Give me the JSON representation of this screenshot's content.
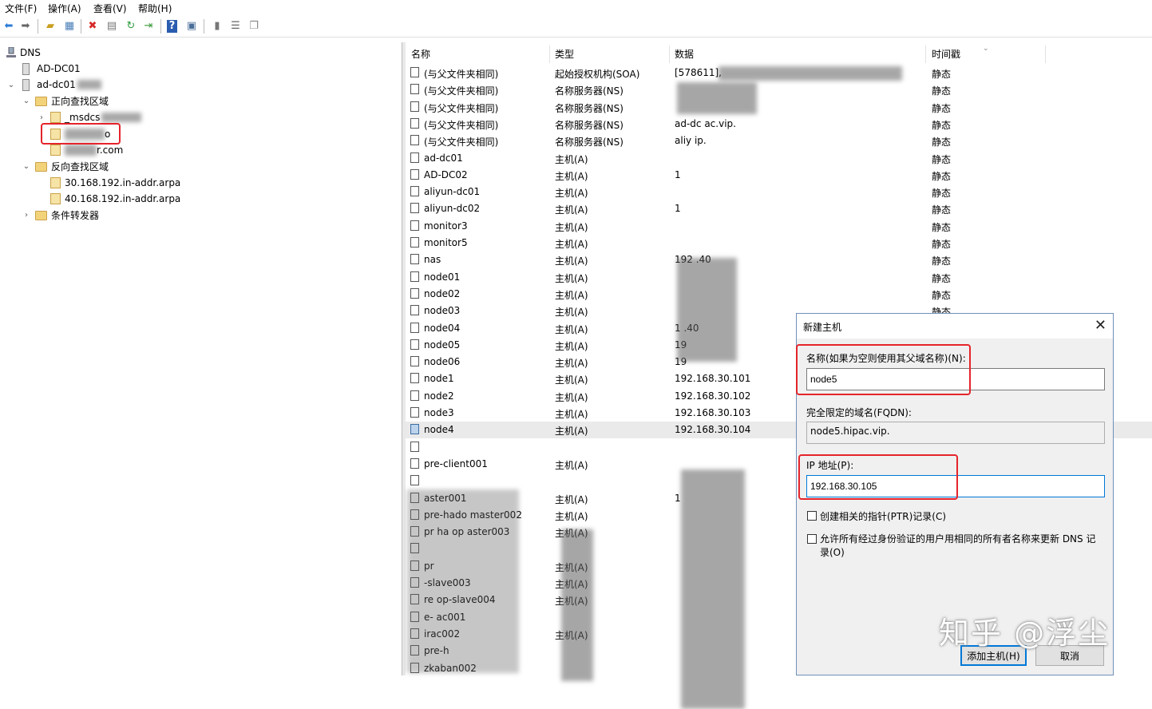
{
  "menu": [
    "文件(F)",
    "操作(A)",
    "查看(V)",
    "帮助(H)"
  ],
  "toolbar_icons": [
    "back-icon",
    "forward-icon",
    "up-folder-icon",
    "show-tree-icon",
    "delete-icon",
    "properties-icon",
    "refresh-icon",
    "export-icon",
    "help-icon",
    "view-icon",
    "server-icon",
    "list-icon",
    "records-icon"
  ],
  "tree": {
    "root": "DNS",
    "server1": "AD-DC01",
    "server2": "ad-dc01",
    "forward_zones": "正向查找区域",
    "msdcs": "_msdcs",
    "zone_hidden_suffix": "o",
    "zone_com_suffix": "r.com",
    "reverse_zones": "反向查找区域",
    "rev1": "30.168.192.in-addr.arpa",
    "rev2": "40.168.192.in-addr.arpa",
    "forwarders": "条件转发器"
  },
  "list": {
    "headers": [
      "名称",
      "类型",
      "数据",
      "时间戳"
    ],
    "rows": [
      {
        "name": "(与父文件夹相同)",
        "type": "起始授权机构(SOA)",
        "data": "[578611],",
        "ts": "静态"
      },
      {
        "name": "(与父文件夹相同)",
        "type": "名称服务器(NS)",
        "data": "",
        "ts": "静态"
      },
      {
        "name": "(与父文件夹相同)",
        "type": "名称服务器(NS)",
        "data": "",
        "ts": "静态"
      },
      {
        "name": "(与父文件夹相同)",
        "type": "名称服务器(NS)",
        "data": "ad-dc        ac.vip.",
        "ts": "静态"
      },
      {
        "name": "(与父文件夹相同)",
        "type": "名称服务器(NS)",
        "data": "aliy              ip.",
        "ts": "静态"
      },
      {
        "name": "ad-dc01",
        "type": "主机(A)",
        "data": "",
        "ts": "静态"
      },
      {
        "name": "AD-DC02",
        "type": "主机(A)",
        "data": "1",
        "ts": "静态"
      },
      {
        "name": "aliyun-dc01",
        "type": "主机(A)",
        "data": "",
        "ts": "静态"
      },
      {
        "name": "aliyun-dc02",
        "type": "主机(A)",
        "data": "1",
        "ts": "静态"
      },
      {
        "name": "monitor3",
        "type": "主机(A)",
        "data": "",
        "ts": "静态"
      },
      {
        "name": "monitor5",
        "type": "主机(A)",
        "data": "",
        "ts": "静态"
      },
      {
        "name": "nas",
        "type": "主机(A)",
        "data": "192    .40",
        "ts": "静态"
      },
      {
        "name": "node01",
        "type": "主机(A)",
        "data": "",
        "ts": "静态"
      },
      {
        "name": "node02",
        "type": "主机(A)",
        "data": "",
        "ts": "静态"
      },
      {
        "name": "node03",
        "type": "主机(A)",
        "data": "",
        "ts": "静态"
      },
      {
        "name": "node04",
        "type": "主机(A)",
        "data": "1     .40",
        "ts": ""
      },
      {
        "name": "node05",
        "type": "主机(A)",
        "data": "19",
        "ts": ""
      },
      {
        "name": "node06",
        "type": "主机(A)",
        "data": "19",
        "ts": ""
      },
      {
        "name": "node1",
        "type": "主机(A)",
        "data": "192.168.30.101",
        "ts": ""
      },
      {
        "name": "node2",
        "type": "主机(A)",
        "data": "192.168.30.102",
        "ts": ""
      },
      {
        "name": "node3",
        "type": "主机(A)",
        "data": "192.168.30.103",
        "ts": ""
      },
      {
        "name": "node4",
        "type": "主机(A)",
        "data": "192.168.30.104",
        "ts": ""
      },
      {
        "name": "",
        "type": "",
        "data": "",
        "ts": ""
      },
      {
        "name": "pre-client001",
        "type": "主机(A)",
        "data": "",
        "ts": ""
      },
      {
        "name": "",
        "type": "",
        "data": "",
        "ts": ""
      },
      {
        "name": "aster001",
        "type": "主机(A)",
        "data": "1",
        "ts": ""
      },
      {
        "name": "pre-hado   master002",
        "type": "主机(A)",
        "data": "",
        "ts": ""
      },
      {
        "name": "pr  ha  op aster003",
        "type": "主机(A)",
        "data": "",
        "ts": ""
      },
      {
        "name": "",
        "type": "",
        "data": "",
        "ts": ""
      },
      {
        "name": "pr",
        "type": "主机(A)",
        "data": "",
        "ts": ""
      },
      {
        "name": "-slave003",
        "type": "主机(A)",
        "data": "",
        "ts": ""
      },
      {
        "name": "re    op-slave004",
        "type": "主机(A)",
        "data": "",
        "ts": ""
      },
      {
        "name": "e-   ac001",
        "type": "",
        "data": "",
        "ts": ""
      },
      {
        "name": "  irac002",
        "type": "主机(A)",
        "data": "",
        "ts": ""
      },
      {
        "name": "pre-h",
        "type": "",
        "data": "",
        "ts": ""
      },
      {
        "name": "  zkaban002",
        "type": "",
        "data": "",
        "ts": ""
      }
    ]
  },
  "dialog": {
    "title": "新建主机",
    "close": "✕",
    "name_label": "名称(如果为空则使用其父域名称)(N):",
    "name_value": "node5",
    "fqdn_label": "完全限定的域名(FQDN):",
    "fqdn_value": "node5.hipac.vip.",
    "ip_label": "IP 地址(P):",
    "ip_value": "192.168.30.105",
    "ptr_label": "创建相关的指针(PTR)记录(C)",
    "update_label_1": "允许所有经过身份验证的用户用相同的所有者名称来更新 DNS 记",
    "update_label_2": "录(O)",
    "add_button": "添加主机(H)",
    "cancel_button": "取消"
  },
  "watermark": "知乎 @浮尘",
  "colors": {
    "highlight_red": "#e5242b",
    "focus_blue": "#0078d7",
    "selected_row": "#eaeaea"
  }
}
